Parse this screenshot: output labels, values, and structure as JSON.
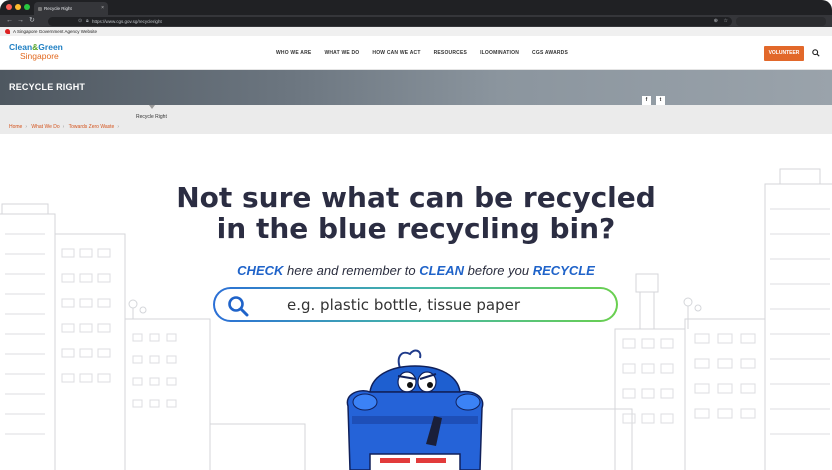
{
  "browser": {
    "tab_title": "Recycle Right",
    "url": "https://www.cgs.gov.sg/recycleright",
    "back_icon": "arrow-left-icon",
    "forward_icon": "arrow-right-icon",
    "reload_icon": "reload-icon"
  },
  "gov_banner": {
    "text": "A Singapore Government Agency Website"
  },
  "site": {
    "logo_line1": "Clean",
    "logo_amp": "&",
    "logo_line1b": "Green",
    "logo_line2": "Singapore",
    "nav": [
      "WHO WE ARE",
      "WHAT WE DO",
      "HOW CAN WE ACT",
      "RESOURCES",
      "ILOOMINATION",
      "CGS AWARDS"
    ],
    "volunteer_label": "VOLUNTEER"
  },
  "hero": {
    "title": "RECYCLE RIGHT",
    "share_fb": "f",
    "share_tw": "t"
  },
  "subnav": {
    "active_item": "Recycle Right",
    "breadcrumb": [
      "Home",
      "What We Do",
      "Towards Zero Waste"
    ],
    "separator": "›"
  },
  "main": {
    "headline_line1": "Not sure what can be recycled",
    "headline_line2": "in the blue recycling bin?",
    "tagline": {
      "w1": "CHECK",
      "t1": " here and remember to ",
      "w2": "CLEAN",
      "t2": " before you ",
      "w3": "RECYCLE"
    },
    "search_placeholder": "e.g. plastic bottle, tissue paper"
  },
  "colors": {
    "accent_blue": "#1f63c9",
    "orange": "#e2682a",
    "headline": "#2b2d42",
    "bin_blue": "#1e5fd0"
  }
}
